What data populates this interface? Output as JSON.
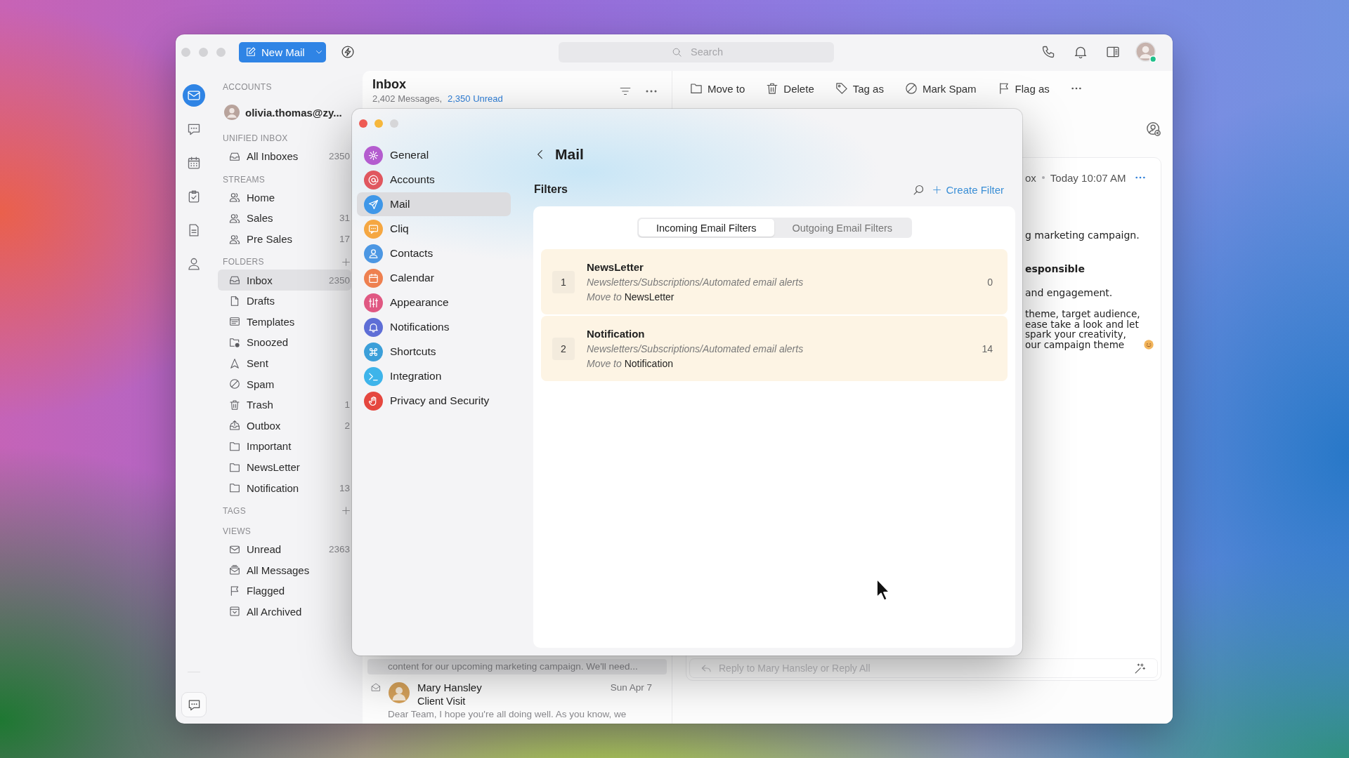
{
  "window": {
    "new_mail": "New Mail",
    "search": {
      "placeholder": "Search"
    }
  },
  "rail": [
    {
      "kind": "mail",
      "selected": true
    },
    {
      "kind": "chat",
      "selected": false
    },
    {
      "kind": "calendar",
      "selected": false
    },
    {
      "kind": "tasks",
      "selected": false
    },
    {
      "kind": "notes",
      "selected": false
    },
    {
      "kind": "contacts",
      "selected": false
    }
  ],
  "sidebar": {
    "sections": [
      {
        "title": "ACCOUNTS",
        "addable": false,
        "items": [
          {
            "kind": "account",
            "label": "olivia.thomas@zy...",
            "selected": false
          }
        ]
      },
      {
        "title": "UNIFIED INBOX",
        "addable": false,
        "items": [
          {
            "kind": "inbox",
            "label": "All Inboxes",
            "count": "2350",
            "selected": false
          }
        ]
      },
      {
        "title": "STREAMS",
        "addable": false,
        "items": [
          {
            "kind": "stream",
            "label": "Home",
            "selected": false
          },
          {
            "kind": "stream",
            "label": "Sales",
            "count": "31",
            "selected": false
          },
          {
            "kind": "stream",
            "label": "Pre Sales",
            "count": "17",
            "selected": false
          }
        ]
      },
      {
        "title": "FOLDERS",
        "addable": true,
        "items": [
          {
            "kind": "inbox",
            "label": "Inbox",
            "count": "2350",
            "selected": true
          },
          {
            "kind": "draft",
            "label": "Drafts",
            "selected": false
          },
          {
            "kind": "template",
            "label": "Templates",
            "selected": false
          },
          {
            "kind": "snoozed",
            "label": "Snoozed",
            "selected": false
          },
          {
            "kind": "sent",
            "label": "Sent",
            "selected": false
          },
          {
            "kind": "spam",
            "label": "Spam",
            "selected": false
          },
          {
            "kind": "trash",
            "label": "Trash",
            "count": "1",
            "selected": false
          },
          {
            "kind": "outbox",
            "label": "Outbox",
            "count": "2",
            "selected": false
          },
          {
            "kind": "folder",
            "label": "Important",
            "selected": false
          },
          {
            "kind": "folder",
            "label": "NewsLetter",
            "selected": false
          },
          {
            "kind": "folder",
            "label": "Notification",
            "count": "13",
            "selected": false
          }
        ]
      },
      {
        "title": "TAGS",
        "addable": true
      },
      {
        "title": "VIEWS",
        "addable": false,
        "items": [
          {
            "kind": "unread",
            "label": "Unread",
            "count": "2363",
            "selected": false
          },
          {
            "kind": "all",
            "label": "All Messages",
            "selected": false
          },
          {
            "kind": "flag",
            "label": "Flagged",
            "selected": false
          },
          {
            "kind": "archive",
            "label": "All Archived",
            "selected": false
          }
        ]
      }
    ]
  },
  "mail_list": {
    "title": "Inbox",
    "message_count": "2,402 Messages,",
    "unread_count": "2,350 Unread",
    "items": [
      {
        "preview": "content for our upcoming marketing campaign. We'll need...",
        "selected": true
      },
      {
        "sender": "Mary Hansley",
        "date": "Sun Apr 7",
        "subject": "Client Visit",
        "preview": "Dear Team, I hope you're all doing well. As you know, we",
        "selected": false
      }
    ]
  },
  "reading_pane": {
    "actions": [
      {
        "kind": "move",
        "label": "Move to"
      },
      {
        "kind": "delete",
        "label": "Delete"
      },
      {
        "kind": "tag",
        "label": "Tag as"
      },
      {
        "kind": "spam",
        "label": "Mark Spam"
      },
      {
        "kind": "flag",
        "label": "Flag as"
      }
    ],
    "message": {
      "folder": "ox",
      "date": "Today 10:07 AM",
      "paragraphs": [
        {
          "kind": "text",
          "lines": [
            "g marketing campaign."
          ],
          "emoji": false
        },
        {
          "kind": "heading",
          "lines": [
            "esponsible"
          ],
          "emoji": false
        },
        {
          "kind": "text",
          "lines": [
            "and engagement."
          ],
          "emoji": false
        },
        {
          "kind": "text",
          "lines": [
            "theme, target audience,",
            "ease take a look and let",
            "spark your creativity,",
            "our campaign theme"
          ],
          "emoji": true
        }
      ]
    },
    "reply": {
      "placeholder": "Reply to Mary Hansley or Reply All"
    }
  },
  "settings": {
    "nav": [
      {
        "kind": "general",
        "label": "General",
        "color": "#b45ccf",
        "selected": false
      },
      {
        "kind": "accounts",
        "label": "Accounts",
        "color": "#e0575f",
        "selected": false
      },
      {
        "kind": "mail",
        "label": "Mail",
        "color": "#3f97e8",
        "selected": true
      },
      {
        "kind": "cliq",
        "label": "Cliq",
        "color": "#f5a742",
        "selected": false
      },
      {
        "kind": "contacts",
        "label": "Contacts",
        "color": "#4c97e3",
        "selected": false
      },
      {
        "kind": "calendar",
        "label": "Calendar",
        "color": "#ee8050",
        "selected": false
      },
      {
        "kind": "appearance",
        "label": "Appearance",
        "color": "#e05882",
        "selected": false
      },
      {
        "kind": "notifications",
        "label": "Notifications",
        "color": "#5e6ed6",
        "selected": false
      },
      {
        "kind": "shortcuts",
        "label": "Shortcuts",
        "color": "#3b9fd9",
        "selected": false
      },
      {
        "kind": "integration",
        "label": "Integration",
        "color": "#3eb4ea",
        "selected": false
      },
      {
        "kind": "privacy",
        "label": "Privacy and Security",
        "color": "#e5473f",
        "selected": false
      }
    ],
    "title": "Mail",
    "section": "Filters",
    "create_filter": "Create Filter",
    "tabs": [
      {
        "label": "Incoming Email Filters",
        "selected": true
      },
      {
        "label": "Outgoing Email Filters",
        "selected": false
      }
    ],
    "filters": [
      {
        "number": "1",
        "name": "NewsLetter",
        "criteria": "Newsletters/Subscriptions/Automated email alerts",
        "action": "*Move to* NewsLetter",
        "count": "0"
      },
      {
        "number": "2",
        "name": "Notification",
        "criteria": "Newsletters/Subscriptions/Automated email alerts",
        "action": "*Move to* Notification",
        "count": "14"
      }
    ]
  }
}
